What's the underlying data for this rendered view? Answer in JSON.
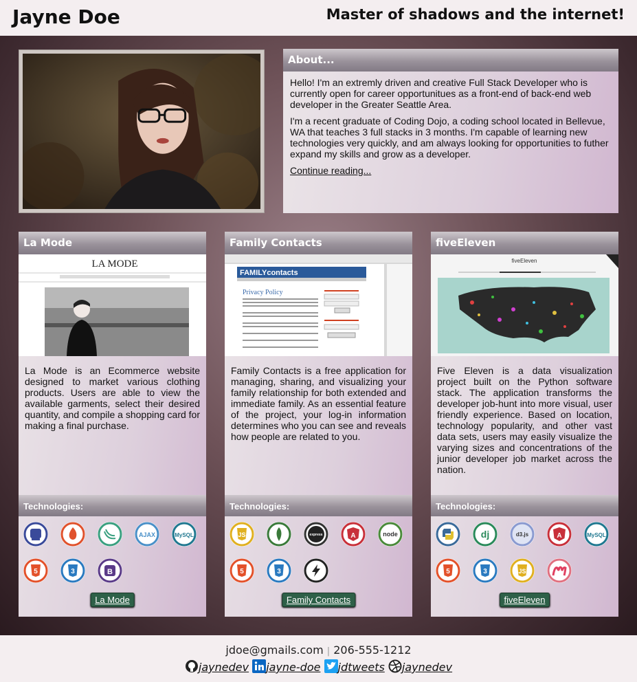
{
  "header": {
    "name": "Jayne Doe",
    "tagline": "Master of shadows and the internet!"
  },
  "about": {
    "title": "About...",
    "p1": "Hello! I'm an extremly driven and creative Full Stack Developer who is currently open for career opportunitues as a front-end of back-end web developer in the Greater Seattle Area.",
    "p2": "I'm a recent graduate of Coding Dojo, a coding school located in Bellevue, WA that teaches 3 full stacks in 3 months. I'm capable of learning new technologies very quickly, and am always looking for opportunities to futher expand my skills and grow as a developer.",
    "link": "Continue reading..."
  },
  "projects": [
    {
      "title": "La Mode",
      "shot_brand": "LA MODE",
      "description": "La Mode is an Ecommerce website designed to market various clothing products. Users are able to view the available garments, select their desired quantity, and compile a shopping card for making a final purchase.",
      "tech_label": "Technologies:",
      "icons": [
        "php-icon",
        "codeigniter-icon",
        "jquery-icon",
        "ajax-icon",
        "mysql-icon",
        "html5-icon",
        "css3-icon",
        "bootstrap-icon"
      ],
      "button": "La Mode"
    },
    {
      "title": "Family Contacts",
      "shot_brand": "FAMILYcontacts",
      "shot_heading": "Privacy Policy",
      "description": "Family Contacts is a free application for managing, sharing, and visualizing your family relationship for both extended and immediate family. As an essential feature of the project, your log-in information determines who you can see and reveals how people are related to you.",
      "tech_label": "Technologies:",
      "icons": [
        "javascript-icon",
        "mongodb-icon",
        "express-icon",
        "angular-icon",
        "nodejs-icon",
        "html5-icon",
        "css3-icon",
        "socketio-icon"
      ],
      "button": "Family Contacts"
    },
    {
      "title": "fiveEleven",
      "shot_brand": "fiveEleven",
      "description": "Five Eleven is a data visualization project built on the Python software stack. The application transforms the developer job-hunt into more visual, user friendly experience. Based on location, technology popularity, and other vast data sets, users may easily visualize the varying sizes and concentrations of the junior developer job market across the nation.",
      "tech_label": "Technologies:",
      "icons": [
        "python-icon",
        "django-icon",
        "d3js-icon",
        "angular-icon",
        "mysql-icon",
        "html5-icon",
        "css3-icon",
        "javascript-icon",
        "materialize-icon"
      ],
      "button": "fiveEleven"
    }
  ],
  "footer": {
    "email": "jdoe@gmails.com",
    "separator": "|",
    "phone": "206-555-1212",
    "github": "jaynedev",
    "linkedin": "jayne-doe",
    "twitter": "jdtweets",
    "dribbble": "jaynedev"
  },
  "colors": {
    "panel_header": "#9a929b",
    "button_bg": "#2e6048",
    "background_dark": "#3e2a30"
  }
}
